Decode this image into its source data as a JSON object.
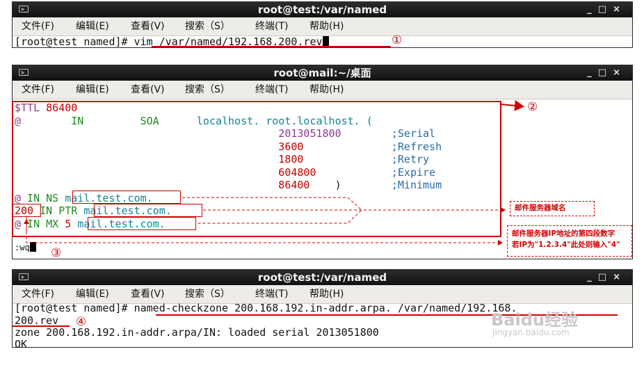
{
  "colors": {
    "red": "#d00000",
    "green": "#1f8a1f",
    "teal": "#14839a",
    "purple": "#8b3a8b",
    "blue": "#2a6aa5"
  },
  "window_controls": [
    "_",
    "□",
    "×"
  ],
  "menu": [
    "文件(F)",
    "编辑(E)",
    "查看(V)",
    "搜索（S）",
    "终端(T)",
    "帮助(H)"
  ],
  "win1": {
    "title": "root@test:/var/named",
    "prompt": "[root@test named]#",
    "command": " vim /var/named/192.168.200.rev",
    "step": "①"
  },
  "win2": {
    "title": "root@mail:~/桌面",
    "ttl_kw": "$TTL",
    "ttl_val": "86400",
    "soa_at": "@",
    "soa_in": "IN",
    "soa_kw": "SOA",
    "soa_host": "localhost. root.localhost. (",
    "serial": "2013051800",
    "serial_c": ";Serial",
    "refresh": "3600",
    "refresh_c": ";Refresh",
    "retry": "1800",
    "retry_c": ";Retry",
    "expire": "604800",
    "expire_c": ";Expire",
    "minimum": "86400",
    "paren": ")",
    "minimum_c": ";Minimum",
    "ns_at": "@",
    "ns_rest": " IN NS ",
    "ns_target": "mail.test.com.",
    "ptr_num": "200",
    "ptr_rest": " IN PTR ",
    "ptr_target": "mail.test.com.",
    "mx_at": "@",
    "mx_rest": " IN MX ",
    "mx_pref": "5",
    "mx_target": "mail.test.com.",
    "vim_cmd": ":wq",
    "step_box": "②",
    "step_cmd": "③",
    "note1": "邮件服务器域名",
    "note2_line1": "邮件服务器IP地址的第四段数字",
    "note2_line2": "若IP为\"1.2.3.4\"此处则输入\"4\""
  },
  "win3": {
    "title": "root@test:/var/named",
    "prompt": "[root@test named]#",
    "command": " named-checkzone 200.168.192.in-addr.arpa. /var/named/192.168.",
    "command_wrap": "200.rev",
    "output1": "zone 200.168.192.in-addr.arpa/IN: loaded serial 2013051800",
    "output2": "OK",
    "step": "④"
  },
  "watermark": {
    "brand": "Baidu经验",
    "url": "jingyan.baidu.com"
  }
}
